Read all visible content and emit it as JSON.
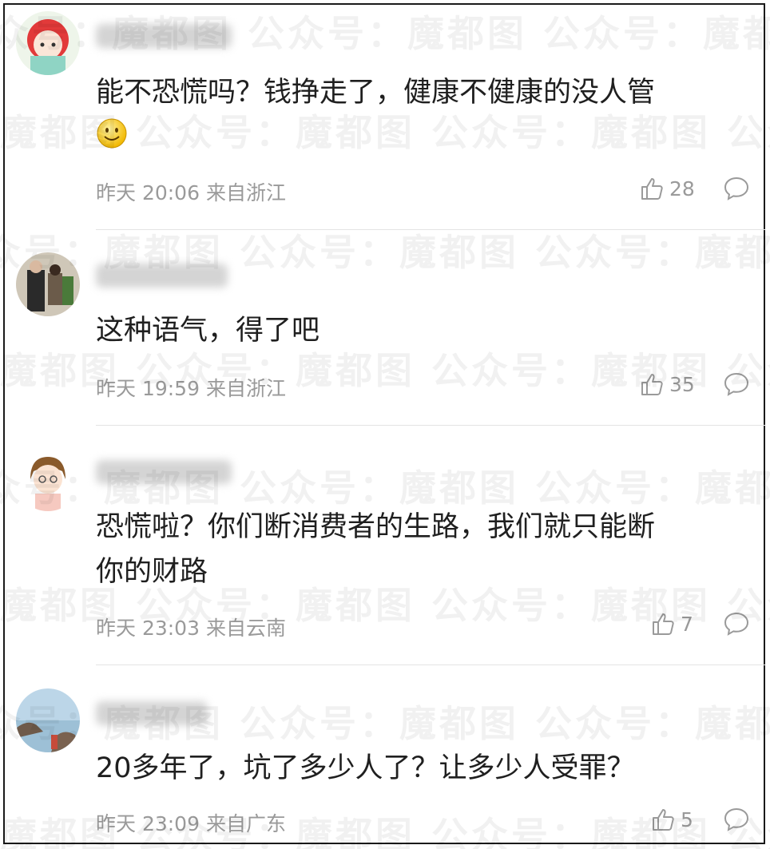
{
  "watermark": "公众号：魔都图",
  "comments": [
    {
      "text": "能不恐慌吗？钱挣走了，健康不健康的没人管",
      "emoji": "smile-emoji",
      "time": "昨天 20:06 来自浙江",
      "likes": "28"
    },
    {
      "text": "这种语气，得了吧",
      "time": "昨天 19:59 来自浙江",
      "likes": "35"
    },
    {
      "text_line1": "恐慌啦？你们断消费者的生路，我们就只能断",
      "text_line2": "你的财路",
      "time": "昨天 23:03 来自云南",
      "likes": "7"
    },
    {
      "text": "20多年了，坑了多少人了？让多少人受罪？",
      "time": "昨天 23:09 来自广东",
      "likes": "5"
    }
  ],
  "colors": {
    "text": "#1f1f1f",
    "meta": "#9a9a9a",
    "divider": "#e4e4e4"
  }
}
